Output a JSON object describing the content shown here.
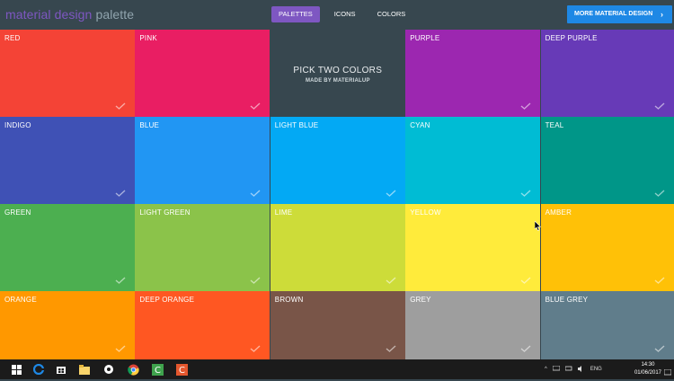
{
  "header": {
    "brand_part1": "material design",
    "brand_part2": "palette",
    "nav": [
      "PALETTES",
      "ICONS",
      "COLORS"
    ],
    "active_nav": "PALETTES",
    "cta": "MORE MATERIAL DESIGN",
    "cta_icon": "chevron-right-icon"
  },
  "center": {
    "title": "PICK TWO COLORS",
    "subtitle": "MADE BY MATERIALUP"
  },
  "tiles": [
    {
      "name": "RED",
      "color": "#f44336",
      "text_color": "#ffffff",
      "check_color": "#ffffff"
    },
    {
      "name": "PINK",
      "color": "#e91e63",
      "text_color": "#ffffff",
      "check_color": "#ffffff"
    },
    {
      "name": "",
      "color": "#37474f",
      "text_color": "#ffffff",
      "check_color": ""
    },
    {
      "name": "PURPLE",
      "color": "#9c27b0",
      "text_color": "#ffffff",
      "check_color": "#ffffff"
    },
    {
      "name": "DEEP PURPLE",
      "color": "#673ab7",
      "text_color": "#ffffff",
      "check_color": "#ffffff"
    },
    {
      "name": "INDIGO",
      "color": "#3f51b5",
      "text_color": "#ffffff",
      "check_color": "#ffffff"
    },
    {
      "name": "BLUE",
      "color": "#2196f3",
      "text_color": "#ffffff",
      "check_color": "#ffffff"
    },
    {
      "name": "LIGHT BLUE",
      "color": "#03a9f4",
      "text_color": "#ffffff",
      "check_color": "#ffffff"
    },
    {
      "name": "CYAN",
      "color": "#00bcd4",
      "text_color": "#ffffff",
      "check_color": "#ffffff"
    },
    {
      "name": "TEAL",
      "color": "#009688",
      "text_color": "#ffffff",
      "check_color": "#ffffff"
    },
    {
      "name": "GREEN",
      "color": "#4caf50",
      "text_color": "#ffffff",
      "check_color": "#ffffff"
    },
    {
      "name": "LIGHT GREEN",
      "color": "#8bc34a",
      "text_color": "#ffffff",
      "check_color": "#ffffff"
    },
    {
      "name": "LIME",
      "color": "#cddc39",
      "text_color": "#ffffff",
      "check_color": "#ffffff"
    },
    {
      "name": "YELLOW",
      "color": "#ffeb3b",
      "text_color": "#ffffff",
      "check_color": "#ffffff"
    },
    {
      "name": "AMBER",
      "color": "#ffc107",
      "text_color": "#ffffff",
      "check_color": "#ffffff"
    },
    {
      "name": "ORANGE",
      "color": "#ff9800",
      "text_color": "#ffffff",
      "check_color": "#ffffff"
    },
    {
      "name": "DEEP ORANGE",
      "color": "#ff5722",
      "text_color": "#ffffff",
      "check_color": "#ffffff"
    },
    {
      "name": "BROWN",
      "color": "#795548",
      "text_color": "#ffffff",
      "check_color": "#ffffff"
    },
    {
      "name": "GREY",
      "color": "#9e9e9e",
      "text_color": "#ffffff",
      "check_color": "#ffffff"
    },
    {
      "name": "BLUE GREY",
      "color": "#607d8b",
      "text_color": "#ffffff",
      "check_color": "#ffffff"
    }
  ],
  "taskbar": {
    "apps": [
      "windows-start-icon",
      "edge-browser-icon",
      "store-icon",
      "file-explorer-icon",
      "settings-icon",
      "chrome-icon",
      "camtasia-icon",
      "camtasia-recorder-icon"
    ],
    "tray_language": "ENG",
    "time": "14:30",
    "date": "01/06/2017"
  }
}
